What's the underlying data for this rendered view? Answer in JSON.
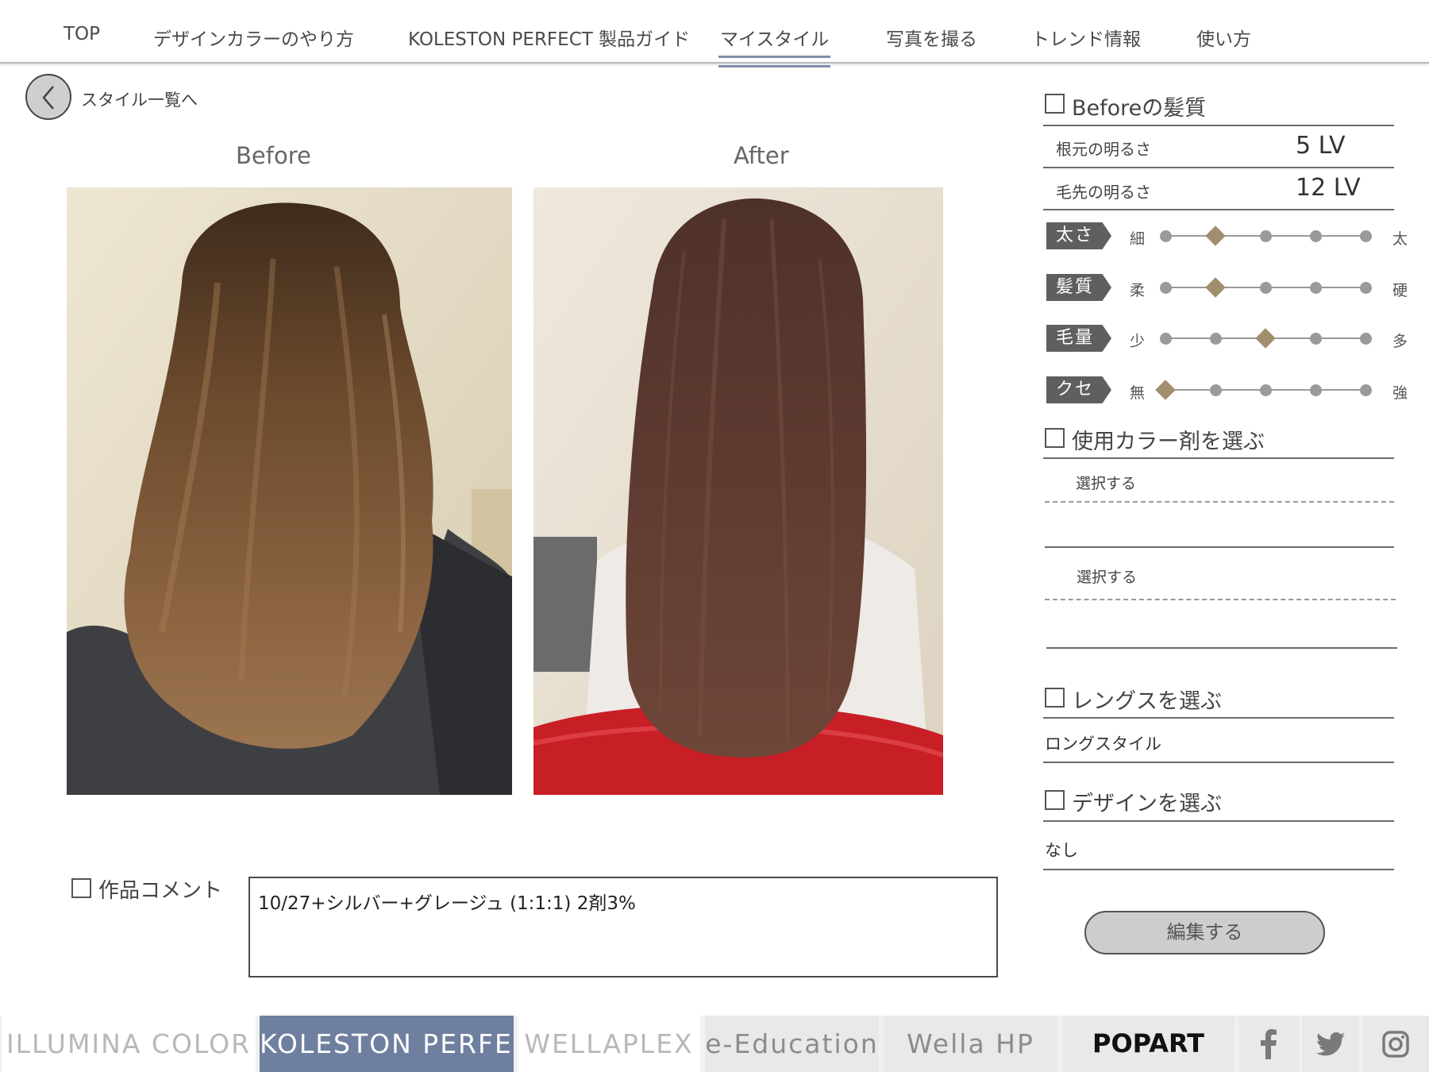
{
  "nav": {
    "items": [
      {
        "label": "TOP"
      },
      {
        "label": "デザインカラーのやり方"
      },
      {
        "label": "KOLESTON PERFECT 製品ガイド"
      },
      {
        "label": "マイスタイル"
      },
      {
        "label": "写真を撮る"
      },
      {
        "label": "トレンド情報"
      },
      {
        "label": "使い方"
      }
    ],
    "active": "マイスタイル",
    "accent_color": "#7f8fad"
  },
  "back": {
    "label": "スタイル一覧へ",
    "icon": "chevron-left-icon"
  },
  "photos": {
    "before_title": "Before",
    "after_title": "After"
  },
  "comment": {
    "label": "作品コメント",
    "checked": false,
    "value": "10/27+シルバー+グレージュ (1:1:1) 2剤3%"
  },
  "hair_quality": {
    "heading": "Beforeの髪質",
    "checked": false,
    "root_label": "根元の明るさ",
    "root_value": "5 LV",
    "tip_label": "毛先の明るさ",
    "tip_value": "12 LV",
    "scales": [
      {
        "name": "太さ",
        "min": "細",
        "max": "太",
        "level": 2,
        "steps": 5
      },
      {
        "name": "髪質",
        "min": "柔",
        "max": "硬",
        "level": 2,
        "steps": 5
      },
      {
        "name": "毛量",
        "min": "少",
        "max": "多",
        "level": 3,
        "steps": 5
      },
      {
        "name": "クセ",
        "min": "無",
        "max": "強",
        "level": 1,
        "steps": 5
      }
    ]
  },
  "color_agent": {
    "heading": "使用カラー剤を選ぶ",
    "checked": false,
    "select1": "選択する",
    "select2": "選択する"
  },
  "length": {
    "heading": "レングスを選ぶ",
    "checked": false,
    "value": "ロングスタイル"
  },
  "design": {
    "heading": "デザインを選ぶ",
    "checked": false,
    "value": "なし"
  },
  "edit_button": "編集する",
  "footer": {
    "links": [
      "ILLUMINA COLOR",
      "KOLESTON PERFECT",
      "WELLAPLEX",
      "e-Education",
      "Wella HP",
      "POPART"
    ],
    "active": "KOLESTON PERFECT",
    "icons": [
      "facebook-icon",
      "twitter-icon",
      "instagram-icon"
    ]
  }
}
